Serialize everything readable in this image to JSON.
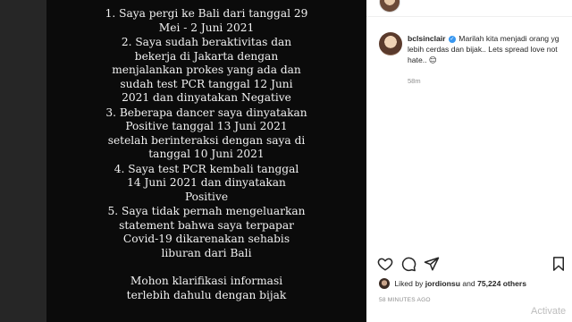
{
  "post": {
    "lines": [
      [
        "1. Saya pergi ke Bali dari tanggal 29",
        "Mei - 2 Juni 2021"
      ],
      [
        "2. Saya sudah beraktivitas dan",
        "bekerja di Jakarta dengan",
        "menjalankan prokes yang ada dan",
        "sudah test PCR tanggal 12 Juni",
        "2021 dan dinyatakan Negative"
      ],
      [
        "3. Beberapa dancer saya dinyatakan",
        "Positive tanggal 13 Juni 2021",
        "setelah berinteraksi dengan saya di",
        "tanggal 10 Juni 2021"
      ],
      [
        "4. Saya test PCR kembali tanggal",
        "14 Juni 2021 dan dinyatakan",
        "Positive"
      ],
      [
        "5. Saya tidak pernah mengeluarkan",
        "statement bahwa saya terpapar",
        "Covid-19 dikarenakan sehabis",
        "liburan dari Bali"
      ]
    ],
    "closing": [
      "Mohon klarifikasi informasi",
      "terlebih dahulu dengan bijak"
    ]
  },
  "comment": {
    "username": "bclsinclair",
    "text": "Marilah kita menjadi orang yg lebih cerdas dan bijak.. Lets spread love not hate..",
    "emoji": "😊",
    "time": "58m"
  },
  "icons": [
    "heart-icon",
    "comment-icon",
    "share-icon",
    "bookmark-icon"
  ],
  "likes": {
    "prefix": "Liked by",
    "user": "jordionsu",
    "middle": "and",
    "count": "75,224 others"
  },
  "posted_ago": "58 MINUTES AGO",
  "watermark": "Activate"
}
